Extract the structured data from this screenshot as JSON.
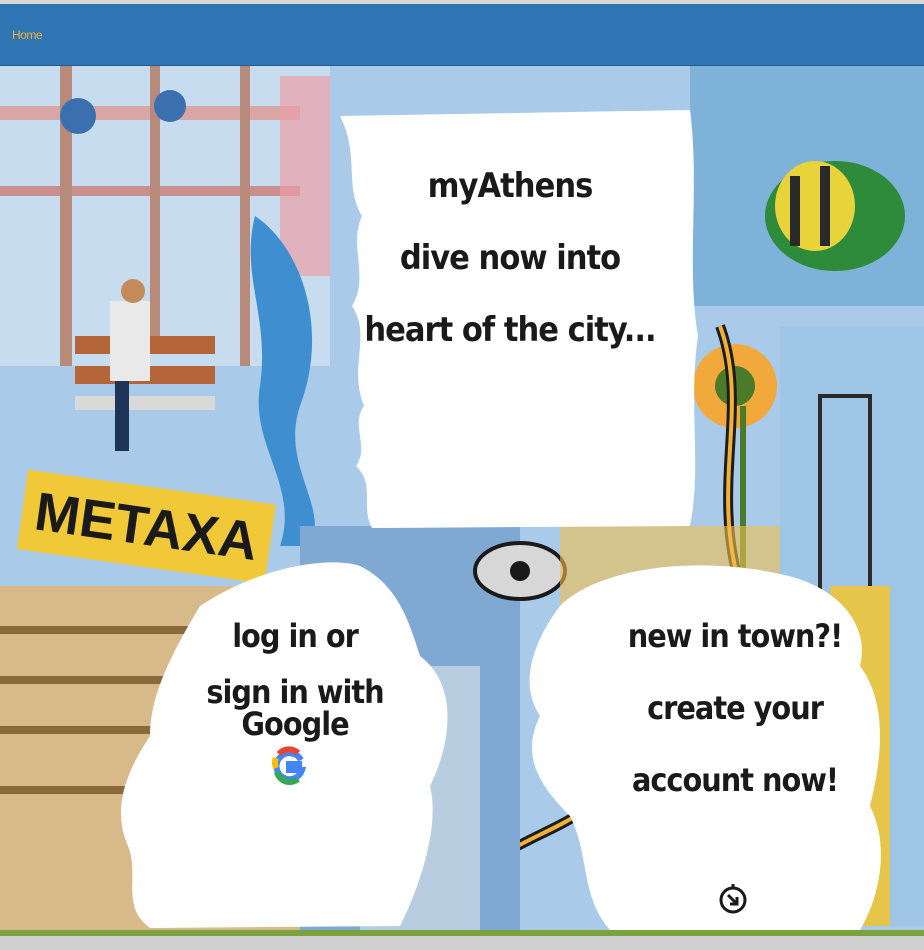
{
  "nav": {
    "home_label": "Home"
  },
  "hero": {
    "sign_text": "METAXA"
  },
  "welcome": {
    "line1": "myAthens",
    "line2": "dive now into",
    "line3": "heart of the city..."
  },
  "login": {
    "line1": "log in or",
    "line2": "sign in with Google",
    "icon": "google-icon"
  },
  "signup": {
    "line1": "new in town?!",
    "line2": "create your",
    "line3": "account now!",
    "icon": "arrow-circle-icon"
  },
  "colors": {
    "navbar": "#2f74b3",
    "nav_link": "#f2b134",
    "bottom_bar": "#7aa23f"
  }
}
